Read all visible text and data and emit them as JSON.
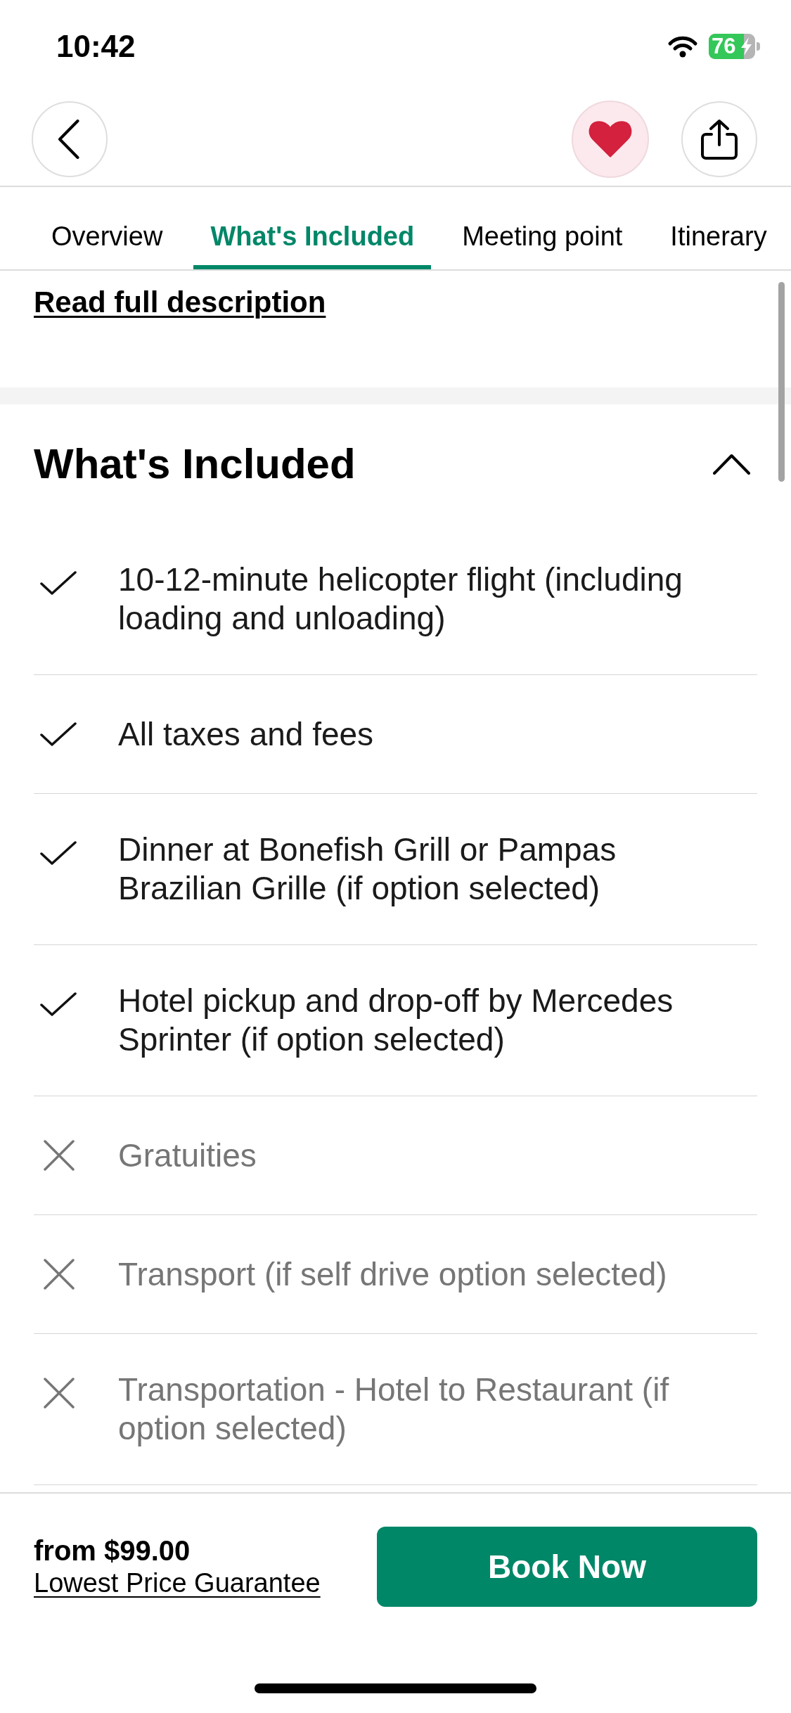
{
  "status_bar": {
    "time": "10:42",
    "battery": "76"
  },
  "favorite": {
    "on": true
  },
  "tabs": [
    {
      "label": "Overview",
      "selected": false
    },
    {
      "label": "What's Included",
      "selected": true
    },
    {
      "label": "Meeting point",
      "selected": false
    },
    {
      "label": "Itinerary",
      "selected": false
    }
  ],
  "description_link": "Read full description",
  "inclusions": {
    "title": "What's Included",
    "expanded": true,
    "items": [
      {
        "text": "10-12-minute helicopter flight (including loading and unloading)",
        "included": true
      },
      {
        "text": "All taxes and fees",
        "included": true
      },
      {
        "text": "Dinner at Bonefish Grill or Pampas Brazilian Grille (if option selected)",
        "included": true
      },
      {
        "text": "Hotel pickup and drop-off by Mercedes Sprinter (if option selected)",
        "included": true
      },
      {
        "text": "Gratuities",
        "included": false
      },
      {
        "text": "Transport (if self drive option selected)",
        "included": false
      },
      {
        "text": "Transportation - Hotel to Restaurant (if option selected)",
        "included": false
      }
    ]
  },
  "booking_bar": {
    "price": "from $99.00",
    "guarantee_link": "Lowest Price Guarantee",
    "button": "Book Now"
  }
}
